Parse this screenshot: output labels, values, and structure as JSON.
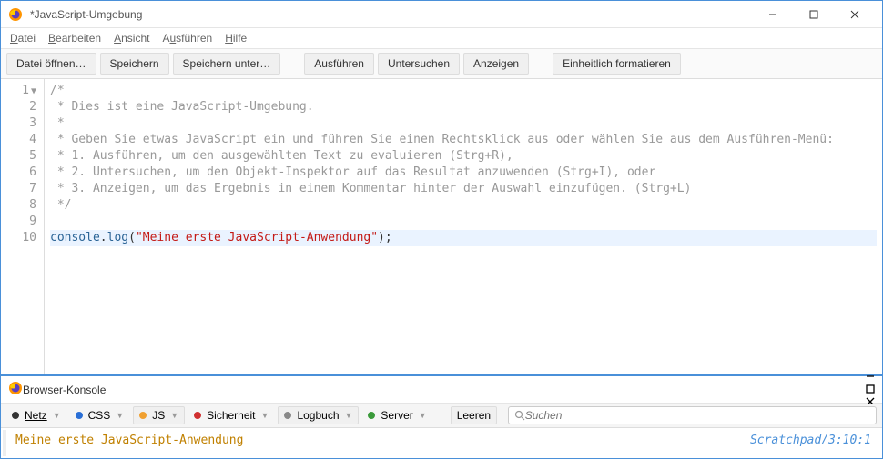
{
  "main": {
    "title": "*JavaScript-Umgebung",
    "menubar": [
      "Datei",
      "Bearbeiten",
      "Ansicht",
      "Ausführen",
      "Hilfe"
    ],
    "toolbar": {
      "open": "Datei öffnen…",
      "save": "Speichern",
      "saveas": "Speichern unter…",
      "run": "Ausführen",
      "inspect": "Untersuchen",
      "display": "Anzeigen",
      "pretty": "Einheitlich formatieren"
    },
    "code": {
      "lines": [
        "/*",
        " * Dies ist eine JavaScript-Umgebung.",
        " *",
        " * Geben Sie etwas JavaScript ein und führen Sie einen Rechtsklick aus oder wählen Sie aus dem Ausführen-Menü:",
        " * 1. Ausführen, um den ausgewählten Text zu evaluieren (Strg+R),",
        " * 2. Untersuchen, um den Objekt-Inspektor auf das Resultat anzuwenden (Strg+I), oder",
        " * 3. Anzeigen, um das Ergebnis in einem Kommentar hinter der Auswahl einzufügen. (Strg+L)",
        " */",
        "",
        "console.log(\"Meine erste JavaScript-Anwendung\");"
      ],
      "line10": {
        "obj": "console",
        "dot": ".",
        "fn": "log",
        "op": "(",
        "str": "\"Meine erste JavaScript-Anwendung\"",
        "cp": ");"
      }
    }
  },
  "console": {
    "title": "Browser-Konsole",
    "filters": {
      "net": "Netz",
      "css": "CSS",
      "js": "JS",
      "sec": "Sicherheit",
      "log": "Logbuch",
      "server": "Server",
      "clear": "Leeren"
    },
    "search_placeholder": "Suchen",
    "output": {
      "msg": "Meine erste JavaScript-Anwendung",
      "src": "Scratchpad/3:10:1"
    },
    "colors": {
      "net": "#333",
      "css": "#2a6fd6",
      "js": "#f0a030",
      "sec": "#d03030",
      "log": "#888",
      "server": "#3a9a3a"
    }
  }
}
